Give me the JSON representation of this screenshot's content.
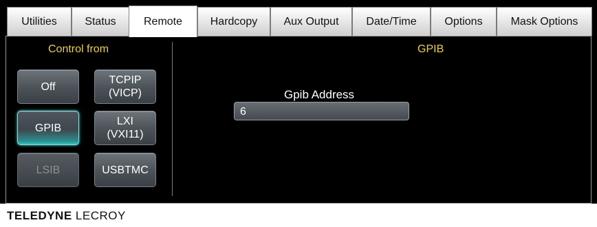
{
  "tabs": [
    {
      "label": "Utilities"
    },
    {
      "label": "Status"
    },
    {
      "label": "Remote",
      "active": true
    },
    {
      "label": "Hardcopy"
    },
    {
      "label": "Aux Output"
    },
    {
      "label": "Date/Time"
    },
    {
      "label": "Options"
    },
    {
      "label": "Mask Options"
    }
  ],
  "control": {
    "heading": "Control from",
    "buttons": [
      {
        "label": "Off",
        "state": "normal"
      },
      {
        "label": "TCPIP\n(VICP)",
        "state": "normal"
      },
      {
        "label": "GPIB",
        "state": "selected"
      },
      {
        "label": "LXI\n(VXI11)",
        "state": "normal"
      },
      {
        "label": "LSIB",
        "state": "disabled"
      },
      {
        "label": "USBTMC",
        "state": "normal"
      }
    ]
  },
  "gpib": {
    "heading": "GPIB",
    "address_label": "Gpib Address",
    "address_value": "6"
  },
  "footer": {
    "brand_bold": "TELEDYNE",
    "brand_light": "LECROY"
  },
  "colors": {
    "accent_heading": "#e8cf55",
    "selected_glow": "#35c6c2"
  }
}
